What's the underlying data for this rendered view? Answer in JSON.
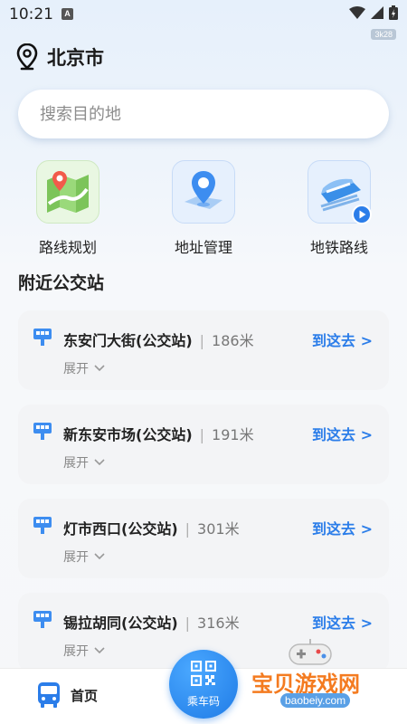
{
  "status_bar": {
    "time": "10:21",
    "notification": "A",
    "badge": "3k28"
  },
  "location": {
    "city": "北京市"
  },
  "search": {
    "placeholder": "搜索目的地"
  },
  "shortcuts": [
    {
      "label": "路线规划",
      "icon": "route-map-icon"
    },
    {
      "label": "地址管理",
      "icon": "address-pin-icon"
    },
    {
      "label": "地铁路线",
      "icon": "subway-train-icon"
    }
  ],
  "nearby": {
    "title": "附近公交站",
    "stops": [
      {
        "name": "东安门大街(公交站)",
        "distance": "186米",
        "go": "到这去 >",
        "expand": "展开"
      },
      {
        "name": "新东安市场(公交站)",
        "distance": "191米",
        "go": "到这去 >",
        "expand": "展开"
      },
      {
        "name": "灯市西口(公交站)",
        "distance": "301米",
        "go": "到这去 >",
        "expand": "展开"
      },
      {
        "name": "锡拉胡同(公交站)",
        "distance": "316米",
        "go": "到这去 >",
        "expand": "展开"
      }
    ]
  },
  "bottom_nav": {
    "home_label": "首页",
    "qr_label": "乘车码"
  },
  "watermark": {
    "text": "宝贝游戏网",
    "url": "baobeiy.com"
  },
  "colors": {
    "accent": "#2b7de9",
    "watermark": "#f47b20"
  }
}
